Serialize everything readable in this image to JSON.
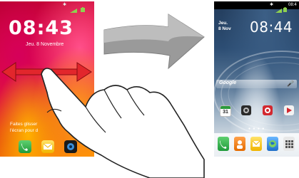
{
  "lock_screen": {
    "time": "08:43",
    "date": "Jeu. 8 Novembre",
    "hint_line1": "Faites glisser",
    "hint_line2": "l'écran pour d"
  },
  "home_screen": {
    "status_time": "08:4",
    "time": "08:44",
    "date_line1": "Jeu.",
    "date_line2": "8 Nov",
    "google_label": "Google",
    "calendar_day": "31"
  },
  "icons": {
    "left_status": [
      "bluetooth-icon",
      "signal-icon",
      "battery-icon"
    ],
    "swipe_arrow": "double-headed-arrow",
    "transition_arrow": "right-arrow",
    "hand": "hand-icon"
  },
  "colors": {
    "swipe_arrow": "#e2262c",
    "transition_arrow": "#9a9a9a",
    "phone_app": "#2fa44f",
    "contacts_app": "#f07a10",
    "messages_app": "#f3c800",
    "browser_app": "#1f7fd8"
  }
}
